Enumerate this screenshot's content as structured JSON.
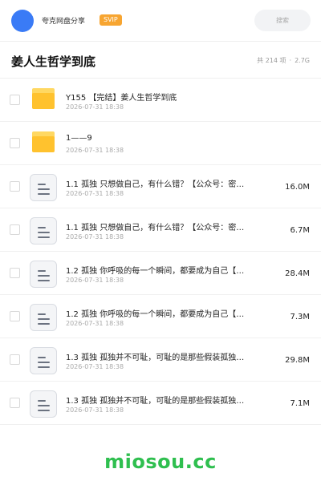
{
  "topbar": {
    "username": "夸克网盘分享",
    "badge": "SVIP",
    "search_placeholder": "搜索"
  },
  "header": {
    "title": "姜人生哲学到底",
    "count": "共 214 项",
    "separator": "·",
    "total_size": "2.7G"
  },
  "files": [
    {
      "type": "folder",
      "name": "Y155 【完结】姜人生哲学到底",
      "date": "2026-07-31 18:38",
      "size": ""
    },
    {
      "type": "folder",
      "name": "1——9",
      "date": "2026-07-31 18:38",
      "size": ""
    },
    {
      "type": "file",
      "name": "1.1 孤独  只想做自己，有什么错？【公众号：密…",
      "date": "2026-07-31 18:38",
      "size": "16.0M"
    },
    {
      "type": "file",
      "name": "1.1 孤独  只想做自己，有什么错？【公众号：密…",
      "date": "2026-07-31 18:38",
      "size": "6.7M"
    },
    {
      "type": "file",
      "name": "1.2 孤独  你呼吸的每一个瞬间，都要成为自己【…",
      "date": "2026-07-31 18:38",
      "size": "28.4M"
    },
    {
      "type": "file",
      "name": "1.2 孤独  你呼吸的每一个瞬间，都要成为自己【…",
      "date": "2026-07-31 18:38",
      "size": "7.3M"
    },
    {
      "type": "file",
      "name": "1.3 孤独  孤独并不可耻，可耻的是那些假装孤独…",
      "date": "2026-07-31 18:38",
      "size": "29.8M"
    },
    {
      "type": "file",
      "name": "1.3 孤独  孤独并不可耻，可耻的是那些假装孤独…",
      "date": "2026-07-31 18:38",
      "size": "7.1M"
    }
  ],
  "watermark": "miosou.cc",
  "colors": {
    "accent_blue": "#3a7bf6",
    "svip_orange": "#f7a531",
    "folder_yellow": "#ffc22e",
    "watermark_green": "#2fbf4f"
  },
  "icons": {
    "folder": "folder-icon",
    "file": "document-icon"
  }
}
